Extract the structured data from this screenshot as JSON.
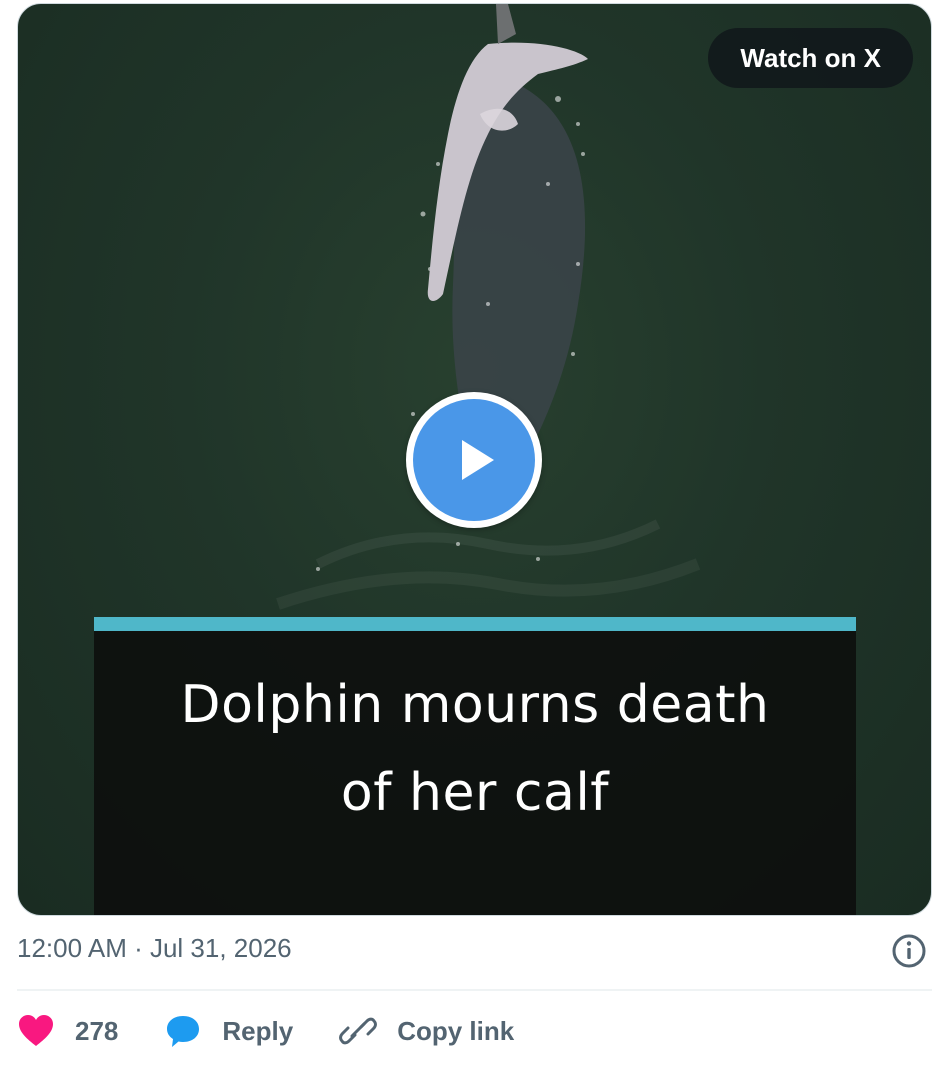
{
  "media": {
    "watch_label": "Watch on X",
    "caption_line1": "Dolphin mourns death",
    "caption_line2": "of her calf",
    "caption_accent_color": "#4fb7c9",
    "play_color": "#4a97e8"
  },
  "footer": {
    "timestamp": "12:00 AM · Jul 31, 2026",
    "info_icon": "info-icon"
  },
  "actions": {
    "like_count": "278",
    "like_icon": "heart-icon",
    "like_color": "#f91880",
    "reply_label": "Reply",
    "reply_icon": "speech-bubble-icon",
    "reply_color": "#1d9bf0",
    "copy_label": "Copy link",
    "copy_icon": "link-icon"
  }
}
